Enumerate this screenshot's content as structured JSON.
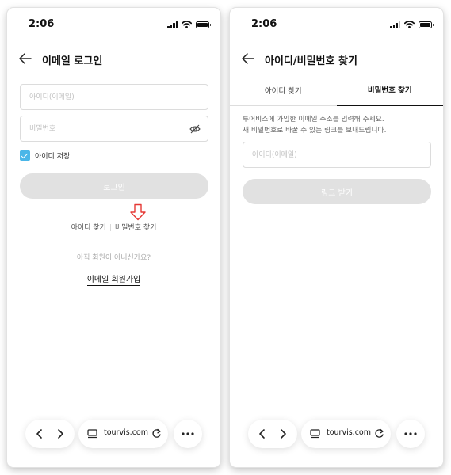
{
  "status": {
    "time": "2:06"
  },
  "login": {
    "title": "이메일 로그인",
    "id_placeholder": "아이디(이메일)",
    "password_placeholder": "비밀번호",
    "remember_label": "아이디 저장",
    "remember_checked": true,
    "login_button": "로그인",
    "find_id": "아이디 찾기",
    "find_password": "비밀번호 찾기",
    "signup_question": "아직 회원이 아니신가요?",
    "signup_link": "이메일 회원가입"
  },
  "find": {
    "title": "아이디/비밀번호 찾기",
    "tabs": [
      "아이디 찾기",
      "비밀번호 찾기"
    ],
    "active_tab": "비밀번호 찾기",
    "description_line1": "투어비스에 가입한 이메일 주소를 입력해 주세요.",
    "description_line2": "새 비밀번호로 바꿀 수 있는 링크를 보내드립니다.",
    "email_placeholder": "아이디(이메일)",
    "submit_button": "링크 받기"
  },
  "browser": {
    "url": "tourvis.com"
  },
  "colors": {
    "accent": "#4ab6e8",
    "annotation_arrow": "#e53935",
    "disabled_button": "#e1e1e1"
  }
}
